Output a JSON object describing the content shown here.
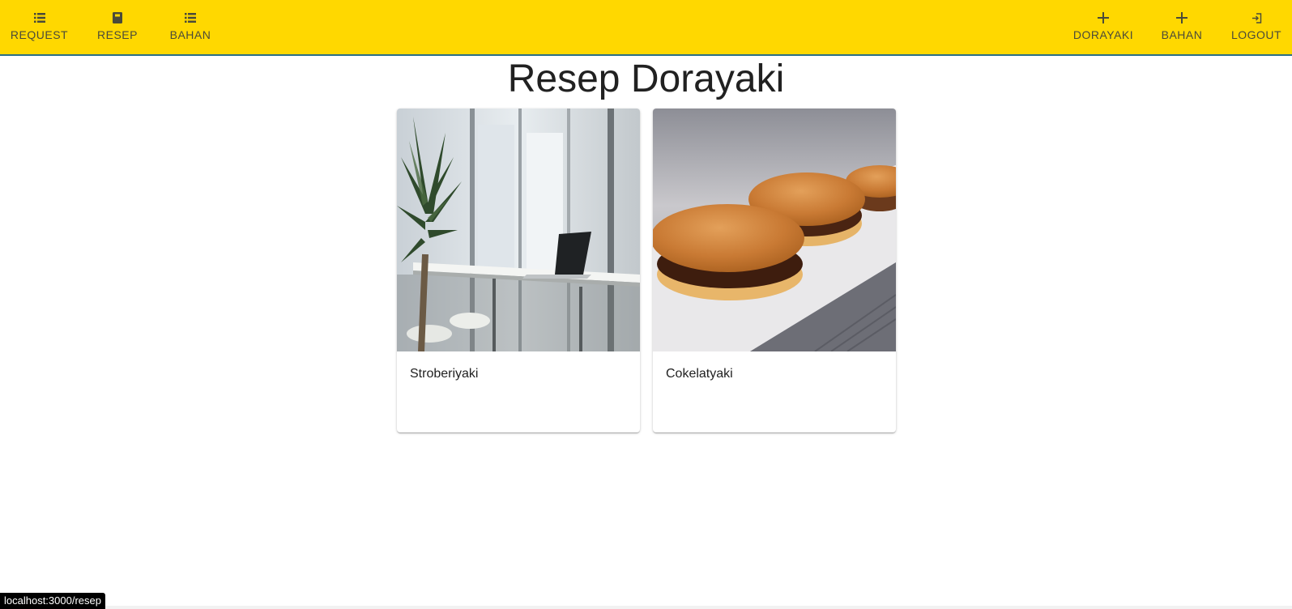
{
  "nav_left": [
    {
      "label": "REQUEST",
      "icon": "list-icon"
    },
    {
      "label": "RESEP",
      "icon": "book-icon"
    },
    {
      "label": "BAHAN",
      "icon": "list-icon"
    }
  ],
  "nav_right": [
    {
      "label": "DORAYAKI",
      "icon": "plus-icon"
    },
    {
      "label": "BAHAN",
      "icon": "plus-icon"
    },
    {
      "label": "LOGOUT",
      "icon": "logout-icon"
    }
  ],
  "page_title": "Resep Dorayaki",
  "cards": [
    {
      "label": "Stroberiyaki",
      "image": "office-window-laptop-photo"
    },
    {
      "label": "Cokelatyaki",
      "image": "dorayaki-plate-photo"
    }
  ],
  "status_url": "localhost:3000/resep",
  "colors": {
    "appbar": "#ffd800",
    "appbar_border": "#2a6f86"
  }
}
